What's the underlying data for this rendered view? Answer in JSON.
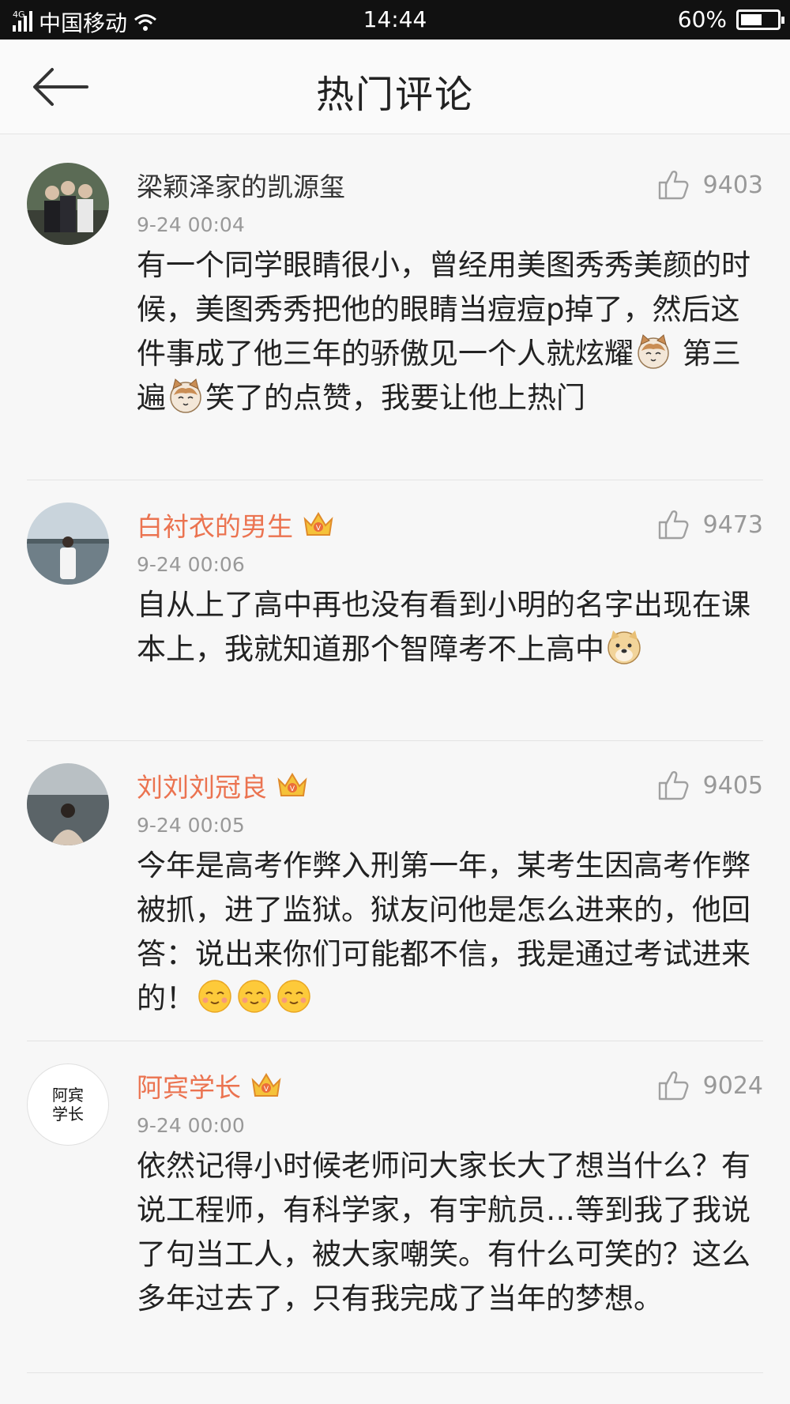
{
  "status_bar": {
    "network": "4G",
    "carrier": "中国移动",
    "time": "14:44",
    "battery": "60%",
    "battery_level": 0.6
  },
  "header": {
    "title": "热门评论",
    "back_icon": "back-arrow-icon"
  },
  "comments": [
    {
      "author": "梁颖泽家的凯源玺",
      "vip": false,
      "time": "9-24 00:04",
      "likes": "9403",
      "text": "有一个同学眼睛很小，曾经用美图秀秀美颜的时候，美图秀秀把他的眼睛当痘痘p掉了，然后这件事成了他三年的骄傲见一个人就炫耀",
      "text2": " 第三遍",
      "text3": "笑了的点赞，我要让他上热门"
    },
    {
      "author": "白衬衣的男生",
      "vip": true,
      "time": "9-24 00:06",
      "likes": "9473",
      "text": "自从上了高中再也没有看到小明的名字出现在课本上，我就知道那个智障考不上高中"
    },
    {
      "author": "刘刘刘冠良",
      "vip": true,
      "time": "9-24 00:05",
      "likes": "9405",
      "text": "今年是高考作弊入刑第一年，某考生因高考作弊被抓，进了监狱。狱友问他是怎么进来的，他回答：说出来你们可能都不信，我是通过考试进来的！"
    },
    {
      "author": "阿宾学长",
      "vip": true,
      "time": "9-24 00:00",
      "likes": "9024",
      "text": "依然记得小时候老师问大家长大了想当什么？有说工程师，有科学家，有宇航员…等到我了我说了句当工人，被大家嘲笑。有什么可笑的？这么多年过去了，只有我完成了当年的梦想。",
      "avatar_text": "阿宾学长"
    }
  ],
  "colors": {
    "vip_name": "#eb7350",
    "meta": "#999999",
    "text": "#222222"
  }
}
